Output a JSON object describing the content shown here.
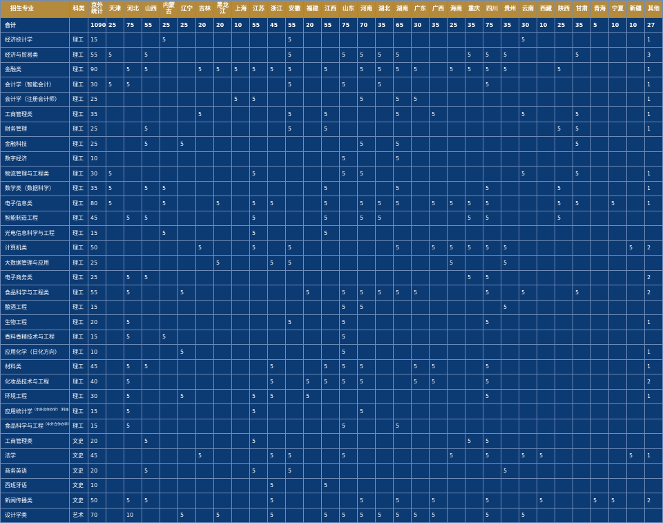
{
  "headers": {
    "major": "招生专业",
    "category": "科类",
    "outside_beijing": "京外统计",
    "provinces": [
      "天津",
      "河北",
      "山西",
      "内蒙古",
      "辽宁",
      "吉林",
      "黑龙江",
      "上海",
      "江苏",
      "浙江",
      "安徽",
      "福建",
      "江西",
      "山东",
      "河南",
      "湖北",
      "湖南",
      "广东",
      "广西",
      "海南",
      "重庆",
      "四川",
      "贵州",
      "云南",
      "西藏",
      "陕西",
      "甘肃",
      "青海",
      "宁夏",
      "新疆",
      "其他"
    ]
  },
  "total": {
    "label": "合计",
    "outside_beijing": "1090",
    "values": [
      "25",
      "75",
      "55",
      "25",
      "25",
      "20",
      "20",
      "10",
      "55",
      "45",
      "55",
      "20",
      "55",
      "75",
      "70",
      "35",
      "65",
      "30",
      "35",
      "25",
      "35",
      "75",
      "35",
      "30",
      "10",
      "25",
      "35",
      "5",
      "10",
      "10",
      "27"
    ]
  },
  "rows": [
    {
      "major": "经济统计学",
      "note": "",
      "category": "理工",
      "total": "15",
      "values": [
        "",
        "",
        "",
        "5",
        "",
        "",
        "",
        "",
        "",
        "",
        "5",
        "",
        "",
        "",
        "",
        "",
        "",
        "",
        "",
        "",
        "",
        "",
        "",
        "5",
        "",
        "",
        "",
        "",
        "",
        "",
        "1"
      ]
    },
    {
      "major": "经济与贸易类",
      "note": "",
      "category": "理工",
      "total": "55",
      "values": [
        "5",
        "",
        "5",
        "",
        "",
        "",
        "",
        "",
        "",
        "",
        "5",
        "",
        "",
        "5",
        "5",
        "5",
        "5",
        "",
        "",
        "",
        "5",
        "5",
        "5",
        "",
        "",
        "",
        "5",
        "",
        "",
        "",
        "3"
      ]
    },
    {
      "major": "金融类",
      "note": "",
      "category": "理工",
      "total": "90",
      "values": [
        "",
        "5",
        "5",
        "",
        "",
        "5",
        "5",
        "5",
        "5",
        "5",
        "5",
        "",
        "5",
        "",
        "5",
        "5",
        "5",
        "5",
        "",
        "5",
        "5",
        "5",
        "5",
        "",
        "",
        "5",
        "",
        "",
        "",
        "",
        "1"
      ]
    },
    {
      "major": "会计学（智能会计）",
      "note": "",
      "category": "理工",
      "total": "30",
      "values": [
        "5",
        "5",
        "",
        "",
        "",
        "",
        "",
        "",
        "",
        "",
        "5",
        "",
        "",
        "5",
        "",
        "5",
        "",
        "",
        "",
        "",
        "",
        "5",
        "",
        "",
        "",
        "",
        "",
        "",
        "",
        "",
        "1"
      ]
    },
    {
      "major": "会计学（注册会计师）",
      "note": "",
      "category": "理工",
      "total": "25",
      "values": [
        "",
        "",
        "",
        "",
        "",
        "",
        "",
        "5",
        "5",
        "",
        "",
        "",
        "",
        "",
        "5",
        "",
        "5",
        "5",
        "",
        "",
        "",
        "",
        "",
        "",
        "",
        "",
        "",
        "",
        "",
        "",
        "1"
      ]
    },
    {
      "major": "工商管理类",
      "note": "",
      "category": "理工",
      "total": "35",
      "values": [
        "",
        "",
        "",
        "",
        "",
        "5",
        "",
        "",
        "",
        "",
        "5",
        "",
        "5",
        "",
        "",
        "",
        "5",
        "",
        "5",
        "",
        "",
        "",
        "",
        "5",
        "",
        "",
        "5",
        "",
        "",
        "",
        "1"
      ]
    },
    {
      "major": "财务管理",
      "note": "",
      "category": "理工",
      "total": "25",
      "values": [
        "",
        "",
        "5",
        "",
        "",
        "",
        "",
        "",
        "",
        "",
        "5",
        "",
        "5",
        "",
        "",
        "",
        "",
        "",
        "",
        "",
        "",
        "",
        "",
        "",
        "",
        "5",
        "5",
        "",
        "",
        "",
        "1"
      ]
    },
    {
      "major": "金融科技",
      "note": "",
      "category": "理工",
      "total": "25",
      "values": [
        "",
        "",
        "5",
        "",
        "5",
        "",
        "",
        "",
        "",
        "",
        "",
        "",
        "",
        "",
        "5",
        "",
        "5",
        "",
        "",
        "",
        "",
        "",
        "",
        "",
        "",
        "",
        "5",
        "",
        "",
        "",
        ""
      ]
    },
    {
      "major": "数字经济",
      "note": "",
      "category": "理工",
      "total": "10",
      "values": [
        "",
        "",
        "",
        "",
        "",
        "",
        "",
        "",
        "",
        "",
        "",
        "",
        "",
        "5",
        "",
        "",
        "5",
        "",
        "",
        "",
        "",
        "",
        "",
        "",
        "",
        "",
        "",
        "",
        "",
        "",
        ""
      ]
    },
    {
      "major": "物流管理与工程类",
      "note": "",
      "category": "理工",
      "total": "30",
      "values": [
        "5",
        "",
        "",
        "",
        "",
        "",
        "",
        "",
        "5",
        "",
        "",
        "",
        "",
        "5",
        "5",
        "",
        "",
        "",
        "",
        "",
        "",
        "",
        "",
        "5",
        "",
        "",
        "5",
        "",
        "",
        "",
        "1"
      ]
    },
    {
      "major": "数学类（数据科学）",
      "note": "",
      "category": "理工",
      "total": "35",
      "values": [
        "5",
        "",
        "5",
        "5",
        "",
        "",
        "",
        "",
        "",
        "",
        "",
        "",
        "5",
        "",
        "",
        "",
        "5",
        "",
        "",
        "",
        "",
        "5",
        "",
        "",
        "",
        "5",
        "",
        "",
        "",
        "",
        "1"
      ]
    },
    {
      "major": "电子信息类",
      "note": "",
      "category": "理工",
      "total": "80",
      "values": [
        "5",
        "",
        "",
        "5",
        "",
        "",
        "5",
        "",
        "5",
        "5",
        "",
        "",
        "5",
        "",
        "5",
        "5",
        "5",
        "",
        "5",
        "5",
        "5",
        "5",
        "",
        "",
        "",
        "5",
        "5",
        "",
        "5",
        "",
        "1"
      ]
    },
    {
      "major": "智能制造工程",
      "note": "",
      "category": "理工",
      "total": "45",
      "values": [
        "",
        "5",
        "5",
        "",
        "",
        "",
        "",
        "",
        "5",
        "",
        "",
        "",
        "5",
        "",
        "5",
        "5",
        "",
        "",
        "",
        "",
        "5",
        "5",
        "",
        "",
        "",
        "5",
        "",
        "",
        "",
        "",
        ""
      ]
    },
    {
      "major": "光电信息科学与工程",
      "note": "",
      "category": "理工",
      "total": "15",
      "values": [
        "",
        "",
        "",
        "5",
        "",
        "",
        "",
        "",
        "5",
        "",
        "",
        "",
        "5",
        "",
        "",
        "",
        "",
        "",
        "",
        "",
        "",
        "",
        "",
        "",
        "",
        "",
        "",
        "",
        "",
        "",
        ""
      ]
    },
    {
      "major": "计算机类",
      "note": "",
      "category": "理工",
      "total": "50",
      "values": [
        "",
        "",
        "",
        "",
        "",
        "5",
        "",
        "",
        "5",
        "",
        "5",
        "",
        "",
        "",
        "",
        "",
        "5",
        "",
        "5",
        "5",
        "5",
        "5",
        "5",
        "",
        "",
        "",
        "",
        "",
        "",
        "5",
        "2"
      ]
    },
    {
      "major": "大数据管理与应用",
      "note": "",
      "category": "理工",
      "total": "25",
      "values": [
        "",
        "",
        "",
        "",
        "",
        "",
        "5",
        "",
        "",
        "5",
        "5",
        "",
        "",
        "",
        "",
        "",
        "",
        "",
        "",
        "5",
        "",
        "",
        "5",
        "",
        "",
        "",
        "",
        "",
        "",
        "",
        ""
      ]
    },
    {
      "major": "电子商务类",
      "note": "",
      "category": "理工",
      "total": "25",
      "values": [
        "",
        "5",
        "5",
        "",
        "",
        "",
        "",
        "",
        "",
        "",
        "",
        "",
        "",
        "",
        "",
        "",
        "",
        "",
        "",
        "",
        "5",
        "5",
        "",
        "",
        "",
        "",
        "",
        "",
        "",
        "",
        "2"
      ]
    },
    {
      "major": "食品科学与工程类",
      "note": "",
      "category": "理工",
      "total": "55",
      "values": [
        "",
        "5",
        "",
        "",
        "5",
        "",
        "",
        "",
        "",
        "",
        "",
        "5",
        "",
        "5",
        "5",
        "5",
        "5",
        "5",
        "",
        "",
        "",
        "5",
        "",
        "5",
        "",
        "",
        "5",
        "",
        "",
        "",
        "2"
      ]
    },
    {
      "major": "酿酒工程",
      "note": "",
      "category": "理工",
      "total": "15",
      "values": [
        "",
        "",
        "",
        "",
        "",
        "",
        "",
        "",
        "",
        "",
        "",
        "",
        "",
        "5",
        "5",
        "",
        "",
        "",
        "",
        "",
        "",
        "",
        "5",
        "",
        "",
        "",
        "",
        "",
        "",
        "",
        ""
      ]
    },
    {
      "major": "生物工程",
      "note": "",
      "category": "理工",
      "total": "20",
      "values": [
        "",
        "5",
        "",
        "",
        "",
        "",
        "",
        "",
        "",
        "",
        "5",
        "",
        "",
        "5",
        "",
        "",
        "",
        "",
        "",
        "",
        "",
        "5",
        "",
        "",
        "",
        "",
        "",
        "",
        "",
        "",
        "1"
      ]
    },
    {
      "major": "香料香精技术与工程",
      "note": "",
      "category": "理工",
      "total": "15",
      "values": [
        "",
        "5",
        "",
        "5",
        "",
        "",
        "",
        "",
        "",
        "",
        "",
        "",
        "",
        "5",
        "",
        "",
        "",
        "",
        "",
        "",
        "",
        "",
        "",
        "",
        "",
        "",
        "",
        "",
        "",
        "",
        ""
      ]
    },
    {
      "major": "应用化学（日化方向）",
      "note": "",
      "category": "理工",
      "total": "10",
      "values": [
        "",
        "",
        "",
        "",
        "5",
        "",
        "",
        "",
        "",
        "",
        "",
        "",
        "",
        "5",
        "",
        "",
        "",
        "",
        "",
        "",
        "",
        "",
        "",
        "",
        "",
        "",
        "",
        "",
        "",
        "",
        "1"
      ]
    },
    {
      "major": "材料类",
      "note": "",
      "category": "理工",
      "total": "45",
      "values": [
        "",
        "5",
        "5",
        "",
        "",
        "",
        "",
        "",
        "",
        "5",
        "",
        "",
        "5",
        "5",
        "5",
        "",
        "",
        "5",
        "5",
        "",
        "",
        "5",
        "",
        "",
        "",
        "",
        "",
        "",
        "",
        "",
        "1"
      ]
    },
    {
      "major": "化妆品技术与工程",
      "note": "",
      "category": "理工",
      "total": "40",
      "values": [
        "",
        "5",
        "",
        "",
        "",
        "",
        "",
        "",
        "",
        "5",
        "",
        "5",
        "5",
        "5",
        "5",
        "",
        "",
        "5",
        "5",
        "",
        "",
        "5",
        "",
        "",
        "",
        "",
        "",
        "",
        "",
        "",
        "2"
      ]
    },
    {
      "major": "环境工程",
      "note": "",
      "category": "理工",
      "total": "30",
      "values": [
        "",
        "5",
        "",
        "",
        "5",
        "",
        "",
        "",
        "5",
        "5",
        "",
        "5",
        "",
        "",
        "",
        "",
        "",
        "",
        "",
        "",
        "",
        "5",
        "",
        "",
        "",
        "",
        "",
        "",
        "",
        "",
        "1"
      ]
    },
    {
      "major": "应用统计学",
      "note": "（中外合作办学）（科技与精算）",
      "category": "理工",
      "total": "15",
      "values": [
        "",
        "5",
        "",
        "",
        "",
        "",
        "",
        "",
        "5",
        "",
        "",
        "",
        "",
        "",
        "5",
        "",
        "",
        "",
        "",
        "",
        "",
        "",
        "",
        "",
        "",
        "",
        "",
        "",
        "",
        "",
        ""
      ]
    },
    {
      "major": "食品科学与工程",
      "note": "（中外合作办学）（2+2）",
      "category": "理工",
      "total": "15",
      "values": [
        "",
        "5",
        "",
        "",
        "",
        "",
        "",
        "",
        "",
        "",
        "",
        "",
        "",
        "5",
        "",
        "",
        "5",
        "",
        "",
        "",
        "",
        "",
        "",
        "",
        "",
        "",
        "",
        "",
        "",
        "",
        ""
      ]
    },
    {
      "major": "工商管理类",
      "note": "",
      "category": "文史",
      "total": "20",
      "values": [
        "",
        "",
        "5",
        "",
        "",
        "",
        "",
        "",
        "5",
        "",
        "",
        "",
        "",
        "",
        "",
        "",
        "",
        "",
        "",
        "",
        "5",
        "5",
        "",
        "",
        "",
        "",
        "",
        "",
        "",
        "",
        ""
      ]
    },
    {
      "major": "法学",
      "note": "",
      "category": "文史",
      "total": "45",
      "values": [
        "",
        "",
        "",
        "",
        "",
        "5",
        "",
        "",
        "",
        "5",
        "5",
        "",
        "",
        "5",
        "",
        "",
        "",
        "",
        "",
        "5",
        "",
        "5",
        "",
        "5",
        "5",
        "",
        "",
        "",
        "",
        "5",
        "1"
      ]
    },
    {
      "major": "商务英语",
      "note": "",
      "category": "文史",
      "total": "20",
      "values": [
        "",
        "",
        "5",
        "",
        "",
        "",
        "",
        "",
        "5",
        "",
        "5",
        "",
        "",
        "",
        "",
        "",
        "",
        "",
        "",
        "",
        "",
        "",
        "5",
        "",
        "",
        "",
        "",
        "",
        "",
        "",
        ""
      ]
    },
    {
      "major": "西班牙语",
      "note": "",
      "category": "文史",
      "total": "10",
      "values": [
        "",
        "",
        "",
        "",
        "",
        "",
        "",
        "",
        "",
        "5",
        "",
        "",
        "5",
        "",
        "",
        "",
        "",
        "",
        "",
        "",
        "",
        "",
        "",
        "",
        "",
        "",
        "",
        "",
        "",
        "",
        ""
      ]
    },
    {
      "major": "新闻传播类",
      "note": "",
      "category": "文史",
      "total": "50",
      "values": [
        "",
        "5",
        "5",
        "",
        "",
        "",
        "",
        "",
        "",
        "5",
        "",
        "",
        "",
        "",
        "5",
        "",
        "5",
        "",
        "5",
        "",
        "",
        "5",
        "",
        "",
        "5",
        "",
        "",
        "5",
        "5",
        "",
        "2"
      ]
    },
    {
      "major": "设计学类",
      "note": "",
      "category": "艺术",
      "total": "70",
      "values": [
        "",
        "10",
        "",
        "",
        "5",
        "",
        "5",
        "",
        "",
        "5",
        "",
        "",
        "5",
        "5",
        "5",
        "5",
        "5",
        "5",
        "5",
        "",
        "",
        "5",
        "",
        "5",
        "",
        "",
        "",
        "",
        "",
        "",
        ""
      ]
    }
  ]
}
